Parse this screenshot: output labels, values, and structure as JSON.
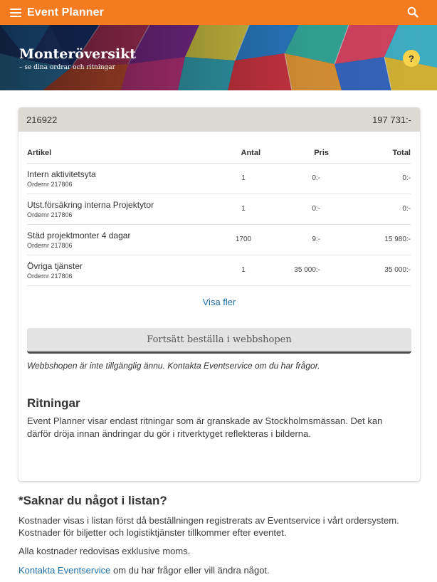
{
  "app": {
    "title": "Event Planner"
  },
  "icons": {
    "menu": "hamburger-menu-icon",
    "search": "search-icon",
    "help": "question-icon"
  },
  "colors": {
    "topbar": "#f47b20",
    "link": "#1f6fa7",
    "help": "#f6d34a",
    "card_header": "#dcd8d4"
  },
  "hero": {
    "title": "Monteröversikt",
    "subtitle": "– se dina ordrar och ritningar",
    "help_label": "?"
  },
  "order": {
    "number": "216922",
    "total": "197 731:-",
    "columns": {
      "article": "Artikel",
      "quantity": "Antal",
      "price": "Pris",
      "total": "Total"
    },
    "rows": [
      {
        "name": "Intern aktivitetsyta",
        "order": "Ordernr 217806",
        "quantity": "1",
        "price": "0:-",
        "total": "0:-"
      },
      {
        "name": "Utst.försäkring interna Projektytor",
        "order": "Ordernr 217806",
        "quantity": "1",
        "price": "0:-",
        "total": "0:-"
      },
      {
        "name": "Städ projektmonter 4 dagar",
        "order": "Ordernr 217806",
        "quantity": "1700",
        "price": "9:-",
        "total": "15 980:-"
      },
      {
        "name": "Övriga tjänster",
        "order": "Ordernr 217806",
        "quantity": "1",
        "price": "35 000:-",
        "total": "35 000:-"
      }
    ],
    "show_more": "Visa fler",
    "shop_button": "Fortsätt beställa i webbshopen",
    "shop_note": "Webbshopen är inte tillgänglig ännu. Kontakta Eventservice om du har frågor."
  },
  "drawings": {
    "title": "Ritningar",
    "text": "Event Planner visar endast ritningar som är granskade av Stockholmsmässan. Det kan därför dröja innan ändringar du gör i ritverktyget reflekteras i bilderna."
  },
  "missing": {
    "title": "*Saknar du något i listan?",
    "p1": "Kostnader visas i listan först då beställningen registrerats av Eventservice i vårt ordersystem. Kostnader för biljetter och logistiktjänster tillkommer efter eventet.",
    "p2": "Alla kostnader redovisas exklusive moms.",
    "link": "Kontakta Eventservice",
    "p3_rest": " om du har frågor eller vill ändra något."
  }
}
